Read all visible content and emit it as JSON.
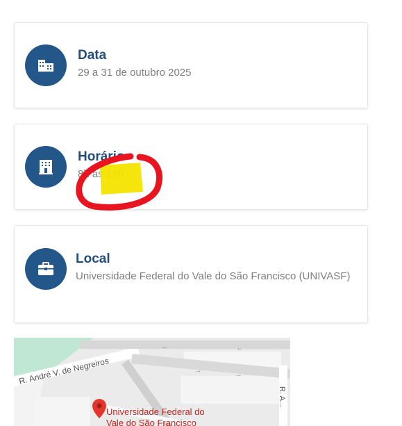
{
  "cards": [
    {
      "icon": "building-icon",
      "title": "Data",
      "text": "29 a 31 de outubro 2025"
    },
    {
      "icon": "hotel-icon",
      "title": "Horário",
      "text": "8h às 17h"
    },
    {
      "icon": "briefcase-icon",
      "title": "Local",
      "text": "Universidade Federal do Vale do São Francisco (UNIVASF)"
    }
  ],
  "map": {
    "street_1": "R. André V. de Negreiros",
    "street_2": "R. A...",
    "poi_name": "Universidade Federal do Vale do São Francisco"
  },
  "colors": {
    "accent": "#23578a",
    "title": "#234e7a",
    "annotation_circle": "#e8141f",
    "annotation_highlight": "#f5e400"
  }
}
